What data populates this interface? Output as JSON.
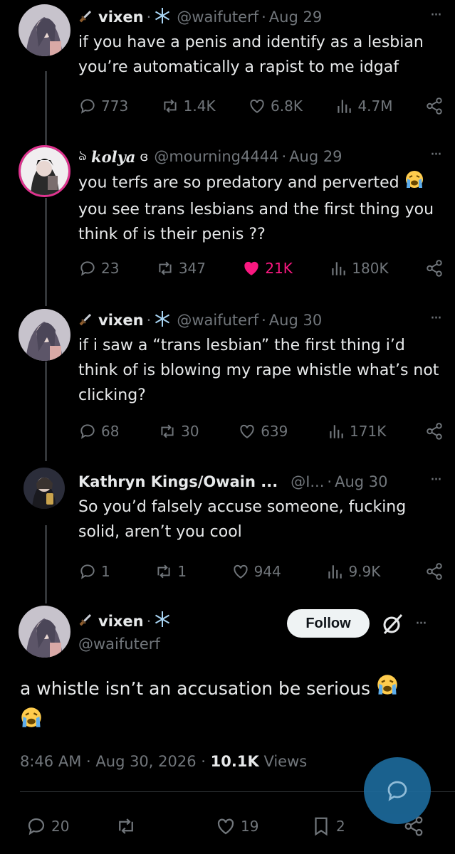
{
  "tweets": [
    {
      "name": "vixen",
      "handle": "@waifuterf",
      "date": "Aug 29",
      "text": "if you have a penis and identify as a lesbian you’re automatically a rapist to me idgaf",
      "replies": "773",
      "reposts": "1.4K",
      "likes": "6.8K",
      "views": "4.7M",
      "liked": false
    },
    {
      "name": "kolya",
      "handle": "@mourning4444",
      "date": "Aug 29",
      "text": "you terfs are so predatory and perverted",
      "text2": "you see trans lesbians and the first thing you think of is their penis ??",
      "replies": "23",
      "reposts": "347",
      "likes": "21K",
      "views": "180K",
      "liked": true
    },
    {
      "name": "vixen",
      "handle": "@waifuterf",
      "date": "Aug 30",
      "text": "if i saw a “trans lesbian” the first thing i’d think of is blowing my rape whistle what’s not clicking?",
      "replies": "68",
      "reposts": "30",
      "likes": "639",
      "views": "171K",
      "liked": false
    },
    {
      "name": "Kathryn Kings/Owain ...",
      "handle": "@I...",
      "date": "Aug 30",
      "text": "So you’d falsely accuse someone, fucking solid, aren’t you cool",
      "replies": "1",
      "reposts": "1",
      "likes": "944",
      "views": "9.9K",
      "liked": false
    }
  ],
  "main": {
    "name": "vixen",
    "handle": "@waifuterf",
    "follow_label": "Follow",
    "text": "a whistle isn’t an accusation be serious",
    "time": "8:46 AM",
    "date": "Aug 30, 2026",
    "views_count": "10.1K",
    "views_label": "Views",
    "replies": "20",
    "likes": "19",
    "bookmarks": "2"
  },
  "separator": "·",
  "more_glyph": "···",
  "colors": {
    "accent_pink": "#f91880",
    "muted": "#71767b",
    "fab": "#1d9bf0"
  },
  "icons": [
    "dagger-icon",
    "snowflake-icon",
    "reply-icon",
    "repost-icon",
    "like-icon",
    "views-icon",
    "share-icon",
    "bookmark-icon",
    "grok-icon",
    "crying-emoji"
  ]
}
